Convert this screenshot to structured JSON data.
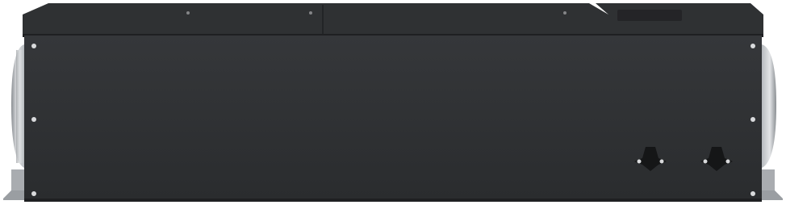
{
  "image": {
    "subject": "ventilation-unit-side-view",
    "text": []
  },
  "colors": {
    "background": "#ffffff",
    "body": "#35373a",
    "body_dark": "#2a2c2e",
    "lid": "#2f3133",
    "lid_edge": "#1f2022",
    "duct_light": "#e3e5e7",
    "duct_mid": "#b7bbbf",
    "duct_dark": "#8a8e92",
    "bracket": "#9a9ea2",
    "screw": "#d9dadc",
    "knob": "#151617"
  }
}
